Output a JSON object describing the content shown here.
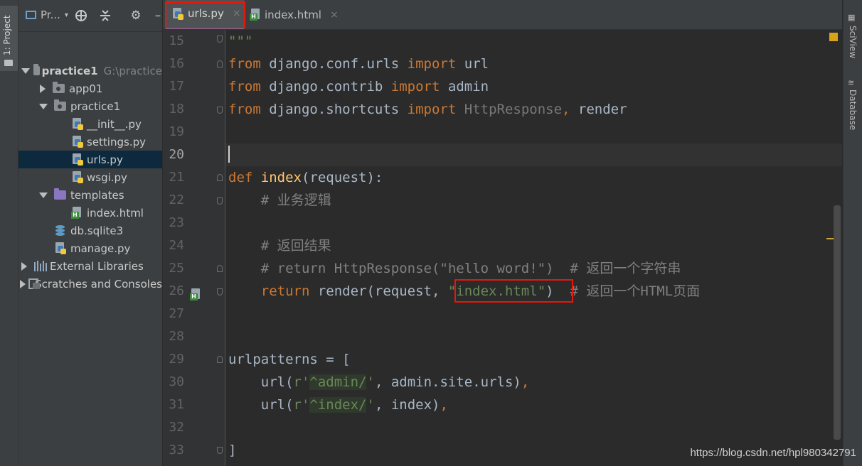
{
  "left_strip": {
    "tool_window_label": "1: Project"
  },
  "project_panel": {
    "title": "Pr...",
    "tree": [
      {
        "label": "practice1",
        "path_hint": "G:\\practice",
        "level": 0
      },
      {
        "label": "app01",
        "level": 1
      },
      {
        "label": "practice1",
        "level": 1
      },
      {
        "label": "__init__.py",
        "level": 2
      },
      {
        "label": "settings.py",
        "level": 2
      },
      {
        "label": "urls.py",
        "level": 2,
        "selected": true
      },
      {
        "label": "wsgi.py",
        "level": 2
      },
      {
        "label": "templates",
        "level": 1
      },
      {
        "label": "index.html",
        "level": 2
      },
      {
        "label": "db.sqlite3",
        "level": 1
      },
      {
        "label": "manage.py",
        "level": 1
      },
      {
        "label": "External Libraries",
        "level": 0
      },
      {
        "label": "Scratches and Consoles",
        "level": 0
      }
    ]
  },
  "tabs": [
    {
      "label": "urls.py",
      "active": true,
      "close": "×"
    },
    {
      "label": "index.html",
      "active": false,
      "close": "×"
    }
  ],
  "editor": {
    "line_numbers": [
      "15",
      "16",
      "17",
      "18",
      "19",
      "20",
      "21",
      "22",
      "23",
      "24",
      "25",
      "26",
      "27",
      "28",
      "29",
      "30",
      "31",
      "32",
      "33"
    ],
    "current_line": "20",
    "code": {
      "l15": "\"\"\"",
      "l16": {
        "k1": "from",
        "mod": " django.conf.urls ",
        "k2": "import",
        "name": " url"
      },
      "l17": {
        "k1": "from",
        "mod": " django.contrib ",
        "k2": "import",
        "name": " admin"
      },
      "l18": {
        "k1": "from",
        "mod": " django.shortcuts ",
        "k2": "import",
        "gray": " HttpResponse",
        "comma": ",",
        "name": " render"
      },
      "l21": {
        "k": "def",
        "fn": " index",
        "rest": "(request):"
      },
      "l22": "    # 业务逻辑",
      "l24": "    # 返回结果",
      "l25": "    # return HttpResponse(\"hello word!\")  # 返回一个字符串",
      "l26": {
        "k": "    return",
        "mid": " render(request, ",
        "str": "\"index.html\"",
        "close": ")",
        "cm": "  # 返回一个HTML页面"
      },
      "l29": "urlpatterns = [",
      "l30": {
        "a": "    url(",
        "r": "r'",
        "rx": "^admin/",
        "q": "'",
        "b": ", admin.site.urls)",
        "c": ","
      },
      "l31": {
        "a": "    url(",
        "r": "r'",
        "rx": "^index/",
        "q": "'",
        "b": ", index)",
        "c": ","
      },
      "l33": "]"
    }
  },
  "right_strip": {
    "labels": [
      "SciView",
      "Database"
    ]
  },
  "watermark": "https://blog.csdn.net/hpl980342791",
  "colors": {
    "keyword": "#cc7832",
    "function": "#ffc66d",
    "comment": "#808080",
    "string": "#6a8759",
    "highlight_box": "#e8170a"
  }
}
